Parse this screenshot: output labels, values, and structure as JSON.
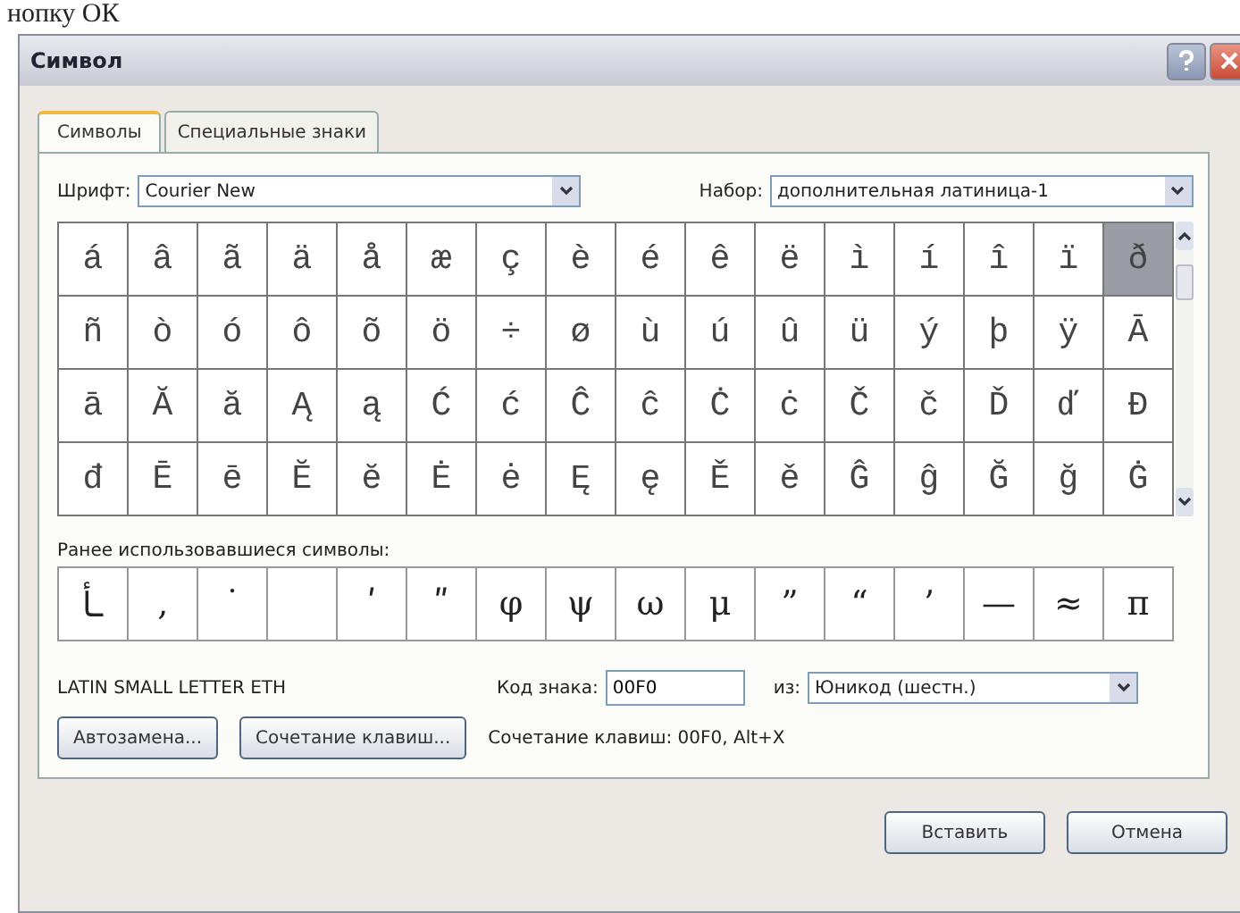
{
  "caption_fragment": "нопку ОК",
  "window": {
    "title": "Символ"
  },
  "tabs": [
    {
      "label": "Символы",
      "selected": true
    },
    {
      "label": "Специальные знаки",
      "selected": false
    }
  ],
  "font": {
    "label": "Шрифт:",
    "value": "Courier New"
  },
  "subset": {
    "label": "Набор:",
    "value": "дополнительная латиница-1"
  },
  "symbols": [
    [
      {
        "char": "á",
        "selected": false
      },
      {
        "char": "â",
        "selected": false
      },
      {
        "char": "ã",
        "selected": false
      },
      {
        "char": "ä",
        "selected": false
      },
      {
        "char": "å",
        "selected": false
      },
      {
        "char": "æ",
        "selected": false
      },
      {
        "char": "ç",
        "selected": false
      },
      {
        "char": "è",
        "selected": false
      },
      {
        "char": "é",
        "selected": false
      },
      {
        "char": "ê",
        "selected": false
      },
      {
        "char": "ë",
        "selected": false
      },
      {
        "char": "ì",
        "selected": false
      },
      {
        "char": "í",
        "selected": false
      },
      {
        "char": "î",
        "selected": false
      },
      {
        "char": "ï",
        "selected": false
      },
      {
        "char": "ð",
        "selected": true
      }
    ],
    [
      {
        "char": "ñ",
        "selected": false
      },
      {
        "char": "ò",
        "selected": false
      },
      {
        "char": "ó",
        "selected": false
      },
      {
        "char": "ô",
        "selected": false
      },
      {
        "char": "õ",
        "selected": false
      },
      {
        "char": "ö",
        "selected": false
      },
      {
        "char": "÷",
        "selected": false
      },
      {
        "char": "ø",
        "selected": false
      },
      {
        "char": "ù",
        "selected": false
      },
      {
        "char": "ú",
        "selected": false
      },
      {
        "char": "û",
        "selected": false
      },
      {
        "char": "ü",
        "selected": false
      },
      {
        "char": "ý",
        "selected": false
      },
      {
        "char": "þ",
        "selected": false
      },
      {
        "char": "ÿ",
        "selected": false
      },
      {
        "char": "Ā",
        "selected": false
      }
    ],
    [
      {
        "char": "ā",
        "selected": false
      },
      {
        "char": "Ă",
        "selected": false
      },
      {
        "char": "ă",
        "selected": false
      },
      {
        "char": "Ą",
        "selected": false
      },
      {
        "char": "ą",
        "selected": false
      },
      {
        "char": "Ć",
        "selected": false
      },
      {
        "char": "ć",
        "selected": false
      },
      {
        "char": "Ĉ",
        "selected": false
      },
      {
        "char": "ĉ",
        "selected": false
      },
      {
        "char": "Ċ",
        "selected": false
      },
      {
        "char": "ċ",
        "selected": false
      },
      {
        "char": "Č",
        "selected": false
      },
      {
        "char": "č",
        "selected": false
      },
      {
        "char": "Ď",
        "selected": false
      },
      {
        "char": "ď",
        "selected": false
      },
      {
        "char": "Đ",
        "selected": false
      }
    ],
    [
      {
        "char": "đ",
        "selected": false
      },
      {
        "char": "Ē",
        "selected": false
      },
      {
        "char": "ē",
        "selected": false
      },
      {
        "char": "Ĕ",
        "selected": false
      },
      {
        "char": "ĕ",
        "selected": false
      },
      {
        "char": "Ė",
        "selected": false
      },
      {
        "char": "ė",
        "selected": false
      },
      {
        "char": "Ę",
        "selected": false
      },
      {
        "char": "ę",
        "selected": false
      },
      {
        "char": "Ě",
        "selected": false
      },
      {
        "char": "ě",
        "selected": false
      },
      {
        "char": "Ĝ",
        "selected": false
      },
      {
        "char": "ĝ",
        "selected": false
      },
      {
        "char": "Ğ",
        "selected": false
      },
      {
        "char": "ğ",
        "selected": false
      },
      {
        "char": "Ġ",
        "selected": false
      }
    ]
  ],
  "recent_label": "Ранее использовавшиеся символы:",
  "recent": [
    {
      "kind": "char",
      "char": "ـأ"
    },
    {
      "kind": "char",
      "char": "‚"
    },
    {
      "kind": "char",
      "char": "˙"
    },
    {
      "kind": "blank"
    },
    {
      "kind": "char",
      "char": "ʹ"
    },
    {
      "kind": "char",
      "char": "ʺ"
    },
    {
      "kind": "char",
      "char": "φ"
    },
    {
      "kind": "char",
      "char": "ψ"
    },
    {
      "kind": "char",
      "char": "ω"
    },
    {
      "kind": "char",
      "char": "μ"
    },
    {
      "kind": "char",
      "char": "”"
    },
    {
      "kind": "char",
      "char": "“"
    },
    {
      "kind": "char",
      "char": "’"
    },
    {
      "kind": "char",
      "char": "—"
    },
    {
      "kind": "char",
      "char": "≈"
    },
    {
      "kind": "char",
      "char": "π"
    }
  ],
  "char_name": "LATIN SMALL LETTER ETH",
  "code": {
    "label": "Код знака:",
    "value": "00F0"
  },
  "from": {
    "label": "из:",
    "value": "Юникод (шестн.)"
  },
  "autocorrect_button": "Автозамена...",
  "shortcut_button": "Сочетание клавиш...",
  "shortcut_text": "Сочетание клавиш: 00F0, Alt+X",
  "buttons": [
    "Вставить",
    "Отмена"
  ]
}
